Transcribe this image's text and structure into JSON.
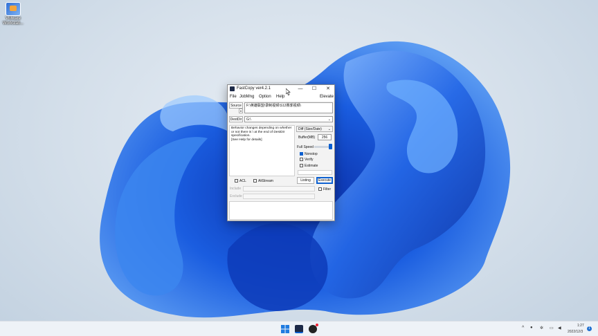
{
  "desktop": {
    "icon_label": "VMware\nWorkstati..."
  },
  "window": {
    "title": "FastCopy ver4.2.1",
    "controls": {
      "minimize": "—",
      "maximize": "☐",
      "close": "✕"
    },
    "menu": [
      "File",
      "JobMng",
      "Option",
      "Help"
    ],
    "elevate": "Elevate",
    "source_button": "Source",
    "source_value": "F:\\英雄联盟\\录制视频\\S12赛季视频\\",
    "destdir_button": "DestDir",
    "destdir_value": "G:\\",
    "info_text": "Behavior changes depending on whether\nor not there is \\ at the end of DestDir\nspecification.\n[See Help for details]",
    "mode_select": "Diff (Size/Date)",
    "buffer_label": "Buffer(MB)",
    "buffer_value": "256",
    "speed_label": "Full Speed",
    "options": [
      {
        "label": "Nonstop",
        "checked": true
      },
      {
        "label": "Verify",
        "checked": false
      },
      {
        "label": "Estimate",
        "checked": false
      }
    ],
    "acl_label": "ACL",
    "altstream_label": "AltStream",
    "listing_button": "Listing",
    "execute_button": "Execute",
    "include_label": "Include",
    "exclude_label": "Exclude",
    "filter_label": "Filter"
  },
  "taskbar": {
    "time": "1:27",
    "date": "2022/12/3",
    "notification_count": "1",
    "tray_chevron": "^"
  },
  "colors": {
    "accent": "#0b5fd0",
    "wallpaper_blue": "#1a5de0"
  }
}
